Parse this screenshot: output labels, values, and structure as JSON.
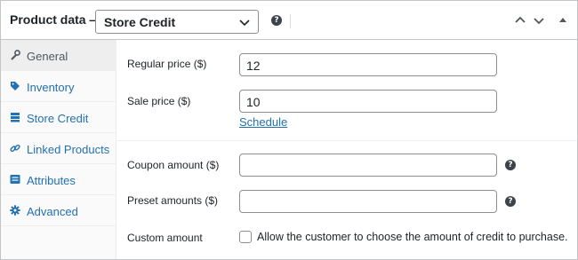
{
  "header": {
    "title": "Product data —",
    "product_type": "Store Credit"
  },
  "sidebar": {
    "items": [
      {
        "label": "General",
        "icon": "wrench-icon",
        "active": true
      },
      {
        "label": "Inventory",
        "icon": "tag-icon",
        "active": false
      },
      {
        "label": "Store Credit",
        "icon": "stack-icon",
        "active": false
      },
      {
        "label": "Linked Products",
        "icon": "link-icon",
        "active": false
      },
      {
        "label": "Attributes",
        "icon": "list-icon",
        "active": false
      },
      {
        "label": "Advanced",
        "icon": "gear-icon",
        "active": false
      }
    ]
  },
  "pricing": {
    "regular_label": "Regular price ($)",
    "regular_value": "12",
    "sale_label": "Sale price ($)",
    "sale_value": "10",
    "schedule_link": "Schedule"
  },
  "credit": {
    "coupon_label": "Coupon amount ($)",
    "coupon_value": "",
    "preset_label": "Preset amounts ($)",
    "preset_value": "",
    "custom_label": "Custom amount",
    "custom_checkbox_text": "Allow the customer to choose the amount of credit to purchase.",
    "custom_checked": false
  },
  "colors": {
    "link": "#2271b1",
    "active_tab_bg": "#eeeeee",
    "border": "#c3c4c7"
  }
}
